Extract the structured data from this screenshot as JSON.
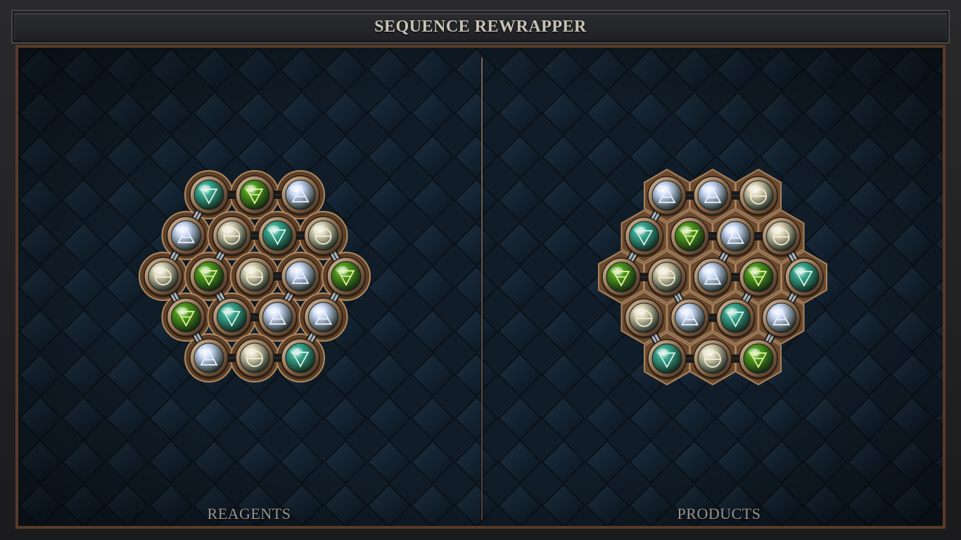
{
  "title": "SEQUENCE REWRAPPER",
  "panels": {
    "reagents_label": "REAGENTS",
    "products_label": "PRODUCTS"
  },
  "colors": {
    "board_bg": "#0f1a24",
    "frame_copper": "#5a3a27",
    "title_text": "#c8c3b7",
    "label_text": "#9c978d",
    "bond": "#aeb6bb"
  },
  "element_types": {
    "air": {
      "name": "Air",
      "symbol": "air-triangle-icon",
      "fill": "#c9d8f5"
    },
    "water": {
      "name": "Water",
      "symbol": "water-triangle-icon",
      "fill": "#3aa88f"
    },
    "earth": {
      "name": "Earth",
      "symbol": "earth-triangle-icon",
      "fill": "#4f9a1c"
    },
    "salt": {
      "name": "Salt",
      "symbol": "salt-circle-icon",
      "fill": "#d8d2b4"
    }
  },
  "reagents": {
    "atoms": [
      {
        "id": "r1",
        "type": "water"
      },
      {
        "id": "r2",
        "type": "earth"
      },
      {
        "id": "r3",
        "type": "air"
      },
      {
        "id": "r4",
        "type": "air"
      },
      {
        "id": "r5",
        "type": "salt"
      },
      {
        "id": "r6",
        "type": "water"
      },
      {
        "id": "r7",
        "type": "salt"
      },
      {
        "id": "r8",
        "type": "salt"
      },
      {
        "id": "r9",
        "type": "earth"
      },
      {
        "id": "r10",
        "type": "salt"
      },
      {
        "id": "r11",
        "type": "air"
      },
      {
        "id": "r12",
        "type": "earth"
      },
      {
        "id": "r13",
        "type": "earth"
      },
      {
        "id": "r14",
        "type": "water"
      },
      {
        "id": "r15",
        "type": "air"
      },
      {
        "id": "r16",
        "type": "air"
      },
      {
        "id": "r17",
        "type": "air"
      },
      {
        "id": "r18",
        "type": "salt"
      },
      {
        "id": "r19",
        "type": "water"
      }
    ],
    "bonds": [
      [
        "r1",
        "r2"
      ],
      [
        "r2",
        "r3"
      ],
      [
        "r1",
        "r4"
      ],
      [
        "r5",
        "r6"
      ],
      [
        "r6",
        "r7"
      ],
      [
        "r4",
        "r8"
      ],
      [
        "r8",
        "r13"
      ],
      [
        "r13",
        "r17"
      ],
      [
        "r17",
        "r18"
      ],
      [
        "r18",
        "r19"
      ],
      [
        "r19",
        "r16"
      ],
      [
        "r16",
        "r12"
      ],
      [
        "r7",
        "r12"
      ],
      [
        "r5",
        "r9"
      ],
      [
        "r9",
        "r14"
      ],
      [
        "r14",
        "r15"
      ],
      [
        "r15",
        "r11"
      ],
      [
        "r11",
        "r10"
      ]
    ]
  },
  "products": {
    "atoms": [
      {
        "id": "p1",
        "type": "air"
      },
      {
        "id": "p2",
        "type": "air"
      },
      {
        "id": "p3",
        "type": "salt"
      },
      {
        "id": "p4",
        "type": "water"
      },
      {
        "id": "p5",
        "type": "earth"
      },
      {
        "id": "p6",
        "type": "air"
      },
      {
        "id": "p7",
        "type": "salt"
      },
      {
        "id": "p8",
        "type": "earth"
      },
      {
        "id": "p9",
        "type": "salt"
      },
      {
        "id": "p10",
        "type": "air"
      },
      {
        "id": "p11",
        "type": "earth"
      },
      {
        "id": "p12",
        "type": "water"
      },
      {
        "id": "p13",
        "type": "salt"
      },
      {
        "id": "p14",
        "type": "air"
      },
      {
        "id": "p15",
        "type": "water"
      },
      {
        "id": "p16",
        "type": "air"
      },
      {
        "id": "p17",
        "type": "water"
      },
      {
        "id": "p18",
        "type": "salt"
      },
      {
        "id": "p19",
        "type": "earth"
      }
    ],
    "bonds": [
      [
        "p1",
        "p2"
      ],
      [
        "p2",
        "p3"
      ],
      [
        "p1",
        "p4"
      ],
      [
        "p4",
        "p8"
      ],
      [
        "p5",
        "p6"
      ],
      [
        "p6",
        "p7"
      ],
      [
        "p7",
        "p12"
      ],
      [
        "p12",
        "p16"
      ],
      [
        "p16",
        "p19"
      ],
      [
        "p8",
        "p9"
      ],
      [
        "p9",
        "p14"
      ],
      [
        "p14",
        "p15"
      ],
      [
        "p15",
        "p11"
      ],
      [
        "p11",
        "p10"
      ],
      [
        "p10",
        "p6"
      ],
      [
        "p13",
        "p17"
      ],
      [
        "p17",
        "p18"
      ],
      [
        "p18",
        "p19"
      ]
    ]
  }
}
